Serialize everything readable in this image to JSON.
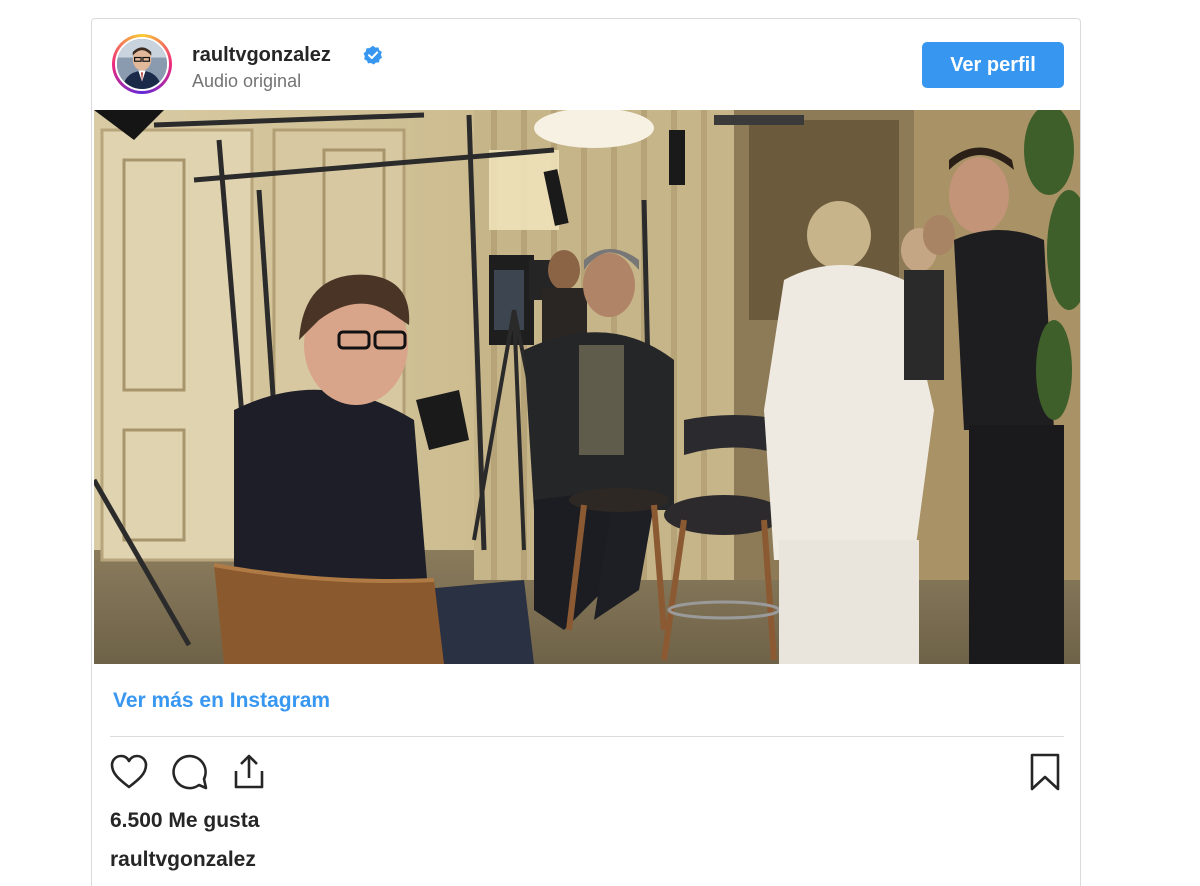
{
  "post": {
    "username": "raultvgonzalez",
    "verified": true,
    "subtitle": "Audio original",
    "follow_button": "Ver perfil",
    "more_link": "Ver más en Instagram",
    "likes": "6.500 Me gusta",
    "caption_username": "raultvgonzalez"
  },
  "icons": {
    "avatar": "avatar-photo",
    "verified": "verified-badge-icon",
    "like": "heart-icon",
    "comment": "comment-icon",
    "share": "share-icon",
    "save": "bookmark-icon"
  },
  "colors": {
    "accent": "#3797f0",
    "link": "#3897f0",
    "text": "#262626",
    "muted": "#737373",
    "border": "#dbdbdb"
  }
}
